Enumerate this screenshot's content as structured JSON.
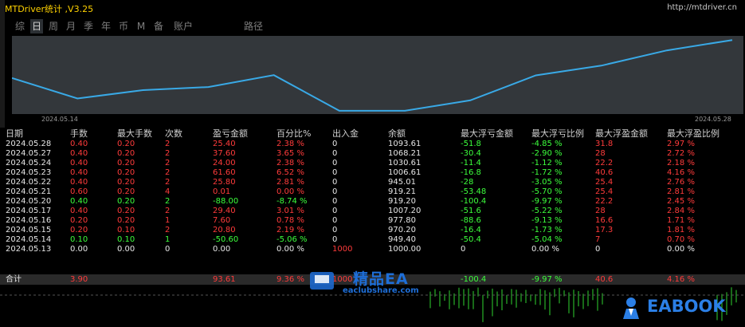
{
  "app": {
    "title": "MTDriver统计 ,V3.25",
    "url": "http://mtdriver.cn"
  },
  "tabs": [
    "综",
    "日",
    "周",
    "月",
    "季",
    "年",
    "币",
    "M",
    "备",
    "账户",
    "路径"
  ],
  "active_tab": "日",
  "chart_data": {
    "type": "line",
    "x": [
      "2024-05-13",
      "2024-05-14",
      "2024-05-15",
      "2024-05-16",
      "2024-05-17",
      "2024-05-20",
      "2024-05-21",
      "2024-05-22",
      "2024-05-23",
      "2024-05-24",
      "2024-05-27",
      "2024-05-28"
    ],
    "values": [
      1000.0,
      949.4,
      970.2,
      977.8,
      1007.2,
      919.2,
      919.21,
      945.01,
      1006.61,
      1030.61,
      1068.21,
      1093.61
    ],
    "start_label": "2024.05.14",
    "end_label": "2024.05.28",
    "color": "#39a9e6",
    "ylim": [
      915,
      1100
    ]
  },
  "table": {
    "headers": [
      "日期",
      "手数",
      "最大手数",
      "次数",
      "盈亏金额",
      "百分比%",
      "出入金",
      "余额",
      "最大浮亏金额",
      "最大浮亏比例",
      "最大浮盈金额",
      "最大浮盈比例"
    ],
    "rows": [
      {
        "date": "2024.05.28",
        "lots": "0.40",
        "maxlots": "0.20",
        "count": "2",
        "pl": "25.40",
        "pct": "2.38 %",
        "io": "0",
        "bal": "1093.61",
        "mfl": "-51.8",
        "mflp": "-4.85 %",
        "mfp": "31.8",
        "mfpp": "2.97 %",
        "sign": "pos"
      },
      {
        "date": "2024.05.27",
        "lots": "0.40",
        "maxlots": "0.20",
        "count": "2",
        "pl": "37.60",
        "pct": "3.65 %",
        "io": "0",
        "bal": "1068.21",
        "mfl": "-30.4",
        "mflp": "-2.90 %",
        "mfp": "28",
        "mfpp": "2.72 %",
        "sign": "pos"
      },
      {
        "date": "2024.05.24",
        "lots": "0.40",
        "maxlots": "0.20",
        "count": "2",
        "pl": "24.00",
        "pct": "2.38 %",
        "io": "0",
        "bal": "1030.61",
        "mfl": "-11.4",
        "mflp": "-1.12 %",
        "mfp": "22.2",
        "mfpp": "2.18 %",
        "sign": "pos"
      },
      {
        "date": "2024.05.23",
        "lots": "0.40",
        "maxlots": "0.20",
        "count": "2",
        "pl": "61.60",
        "pct": "6.52 %",
        "io": "0",
        "bal": "1006.61",
        "mfl": "-16.8",
        "mflp": "-1.72 %",
        "mfp": "40.6",
        "mfpp": "4.16 %",
        "sign": "pos"
      },
      {
        "date": "2024.05.22",
        "lots": "0.40",
        "maxlots": "0.20",
        "count": "2",
        "pl": "25.80",
        "pct": "2.81 %",
        "io": "0",
        "bal": "945.01",
        "mfl": "-28",
        "mflp": "-3.05 %",
        "mfp": "25.4",
        "mfpp": "2.76 %",
        "sign": "pos"
      },
      {
        "date": "2024.05.21",
        "lots": "0.60",
        "maxlots": "0.20",
        "count": "4",
        "pl": "0.01",
        "pct": "0.00 %",
        "io": "0",
        "bal": "919.21",
        "mfl": "-53.48",
        "mflp": "-5.70 %",
        "mfp": "25.4",
        "mfpp": "2.81 %",
        "sign": "pos"
      },
      {
        "date": "2024.05.20",
        "lots": "0.40",
        "maxlots": "0.20",
        "count": "2",
        "pl": "-88.00",
        "pct": "-8.74 %",
        "io": "0",
        "bal": "919.20",
        "mfl": "-100.4",
        "mflp": "-9.97 %",
        "mfp": "22.2",
        "mfpp": "2.45 %",
        "sign": "neg"
      },
      {
        "date": "2024.05.17",
        "lots": "0.40",
        "maxlots": "0.20",
        "count": "2",
        "pl": "29.40",
        "pct": "3.01 %",
        "io": "0",
        "bal": "1007.20",
        "mfl": "-51.6",
        "mflp": "-5.22 %",
        "mfp": "28",
        "mfpp": "2.84 %",
        "sign": "pos"
      },
      {
        "date": "2024.05.16",
        "lots": "0.20",
        "maxlots": "0.20",
        "count": "1",
        "pl": "7.60",
        "pct": "0.78 %",
        "io": "0",
        "bal": "977.80",
        "mfl": "-88.6",
        "mflp": "-9.13 %",
        "mfp": "16.6",
        "mfpp": "1.71 %",
        "sign": "pos"
      },
      {
        "date": "2024.05.15",
        "lots": "0.20",
        "maxlots": "0.10",
        "count": "2",
        "pl": "20.80",
        "pct": "2.19 %",
        "io": "0",
        "bal": "970.20",
        "mfl": "-16.4",
        "mflp": "-1.73 %",
        "mfp": "17.3",
        "mfpp": "1.81 %",
        "sign": "pos"
      },
      {
        "date": "2024.05.14",
        "lots": "0.10",
        "maxlots": "0.10",
        "count": "1",
        "pl": "-50.60",
        "pct": "-5.06 %",
        "io": "0",
        "bal": "949.40",
        "mfl": "-50.4",
        "mflp": "-5.04 %",
        "mfp": "7",
        "mfpp": "0.70 %",
        "sign": "neg"
      },
      {
        "date": "2024.05.13",
        "lots": "0.00",
        "maxlots": "0.00",
        "count": "0",
        "pl": "0.00",
        "pct": "0.00 %",
        "io": "1000",
        "bal": "1000.00",
        "mfl": "0",
        "mflp": "0.00 %",
        "mfp": "0",
        "mfpp": "0.00 %",
        "sign": "zero"
      }
    ],
    "total": {
      "label": "合计",
      "lots": "3.90",
      "pl": "93.61",
      "pct": "9.36 %",
      "io": "1000",
      "mfl": "-100.4",
      "mflp": "-9.97 %",
      "mfp": "40.6",
      "mfpp": "4.16 %"
    }
  },
  "watermark": {
    "ea_text": "精品EA",
    "ea_url": "eaclubshare.com",
    "eabook": "EABOOK"
  },
  "colors": {
    "accent": "#39a9e6",
    "title": "#ffd200",
    "positive": "#ff3b3b",
    "negative": "#3cff3c"
  }
}
